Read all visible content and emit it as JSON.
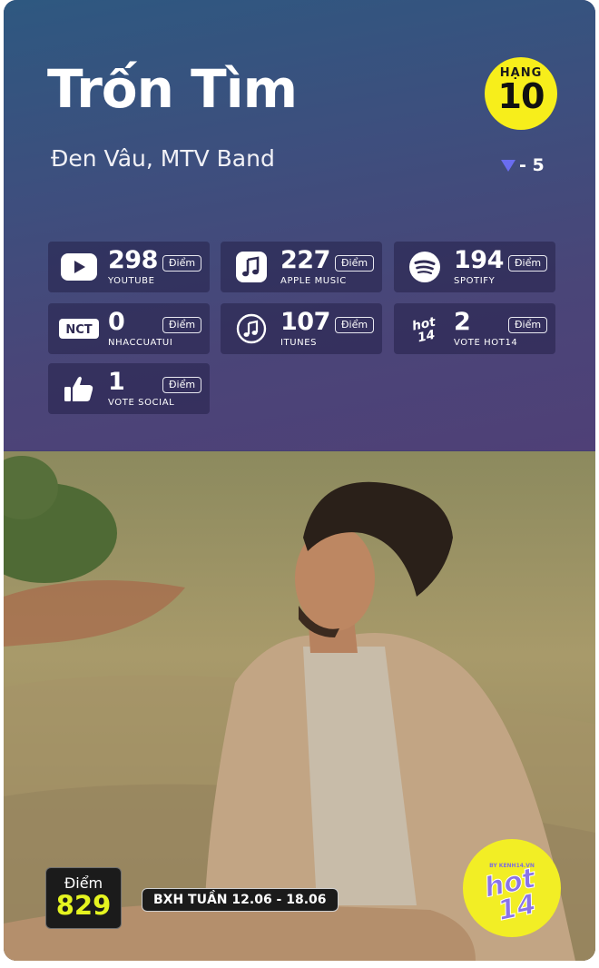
{
  "song": {
    "title": "Trốn Tìm",
    "artists": "Đen Vâu, MTV Band"
  },
  "rank": {
    "label": "HẠNG",
    "number": "10",
    "change": "- 5",
    "direction": "down"
  },
  "sources": [
    {
      "name": "YOUTUBE",
      "value": "298",
      "unit": "Điểm",
      "icon": "youtube-icon"
    },
    {
      "name": "APPLE MUSIC",
      "value": "227",
      "unit": "Điểm",
      "icon": "apple-music-icon"
    },
    {
      "name": "SPOTIFY",
      "value": "194",
      "unit": "Điểm",
      "icon": "spotify-icon"
    },
    {
      "name": "NHACCUATUI",
      "value": "0",
      "unit": "Điểm",
      "icon": "nhaccuatui-icon"
    },
    {
      "name": "ITUNES",
      "value": "107",
      "unit": "Điểm",
      "icon": "itunes-icon"
    },
    {
      "name": "VOTE HOT14",
      "value": "2",
      "unit": "Điểm",
      "icon": "hot14-icon"
    },
    {
      "name": "VOTE SOCIAL",
      "value": "1",
      "unit": "Điểm",
      "icon": "thumbs-up-icon"
    }
  ],
  "nct_logo_text": "NCT",
  "score": {
    "label": "Điểm",
    "value": "829"
  },
  "week": "BXH TUẦN 12.06 - 18.06",
  "logo": {
    "text": "hot14",
    "subtext": "BY KENH14.VN"
  },
  "colors": {
    "accent_yellow": "#f7ee1b",
    "score_yellow": "#e5f420",
    "down_arrow": "#6a6df0",
    "header_top": "#2e5880",
    "header_bottom": "#4f4077"
  }
}
